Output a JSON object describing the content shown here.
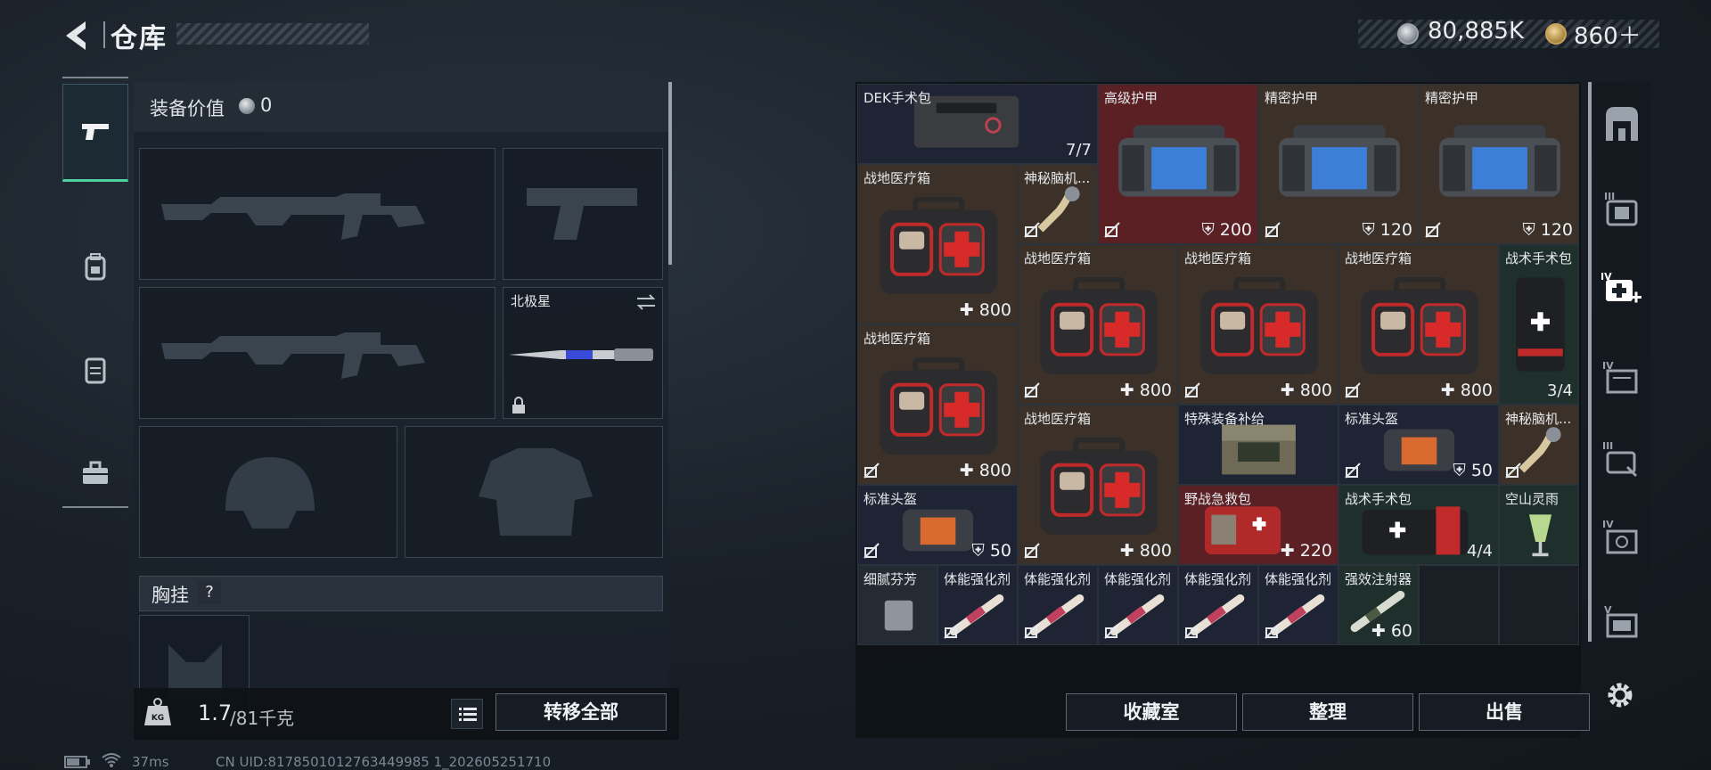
{
  "header": {
    "title": "仓库",
    "currency_silver": "80,885K",
    "currency_gold": "860＋"
  },
  "equipment": {
    "value_label": "装备价值",
    "value": "0",
    "melee_label": "北极星",
    "chest_label": "胸挂",
    "help": "?"
  },
  "weight": {
    "current": "1.7",
    "max": "/81千克",
    "transfer_all": "转移全部"
  },
  "status": {
    "ping": "37ms",
    "uid": "CN UID:8178501012763449985 1_202605251710"
  },
  "inventory": {
    "cells": [
      {
        "name": "DEK手术包",
        "count": "7/7"
      },
      {
        "name": "高级护甲",
        "value": "200"
      },
      {
        "name": "精密护甲",
        "value": "120"
      },
      {
        "name": "精密护甲",
        "value": "120"
      },
      {
        "name": "战地医疗箱",
        "value": "800"
      },
      {
        "name": "神秘脑机..."
      },
      {
        "name": "战地医疗箱",
        "value": "800"
      },
      {
        "name": "战地医疗箱",
        "value": "800"
      },
      {
        "name": "战地医疗箱",
        "value": "800"
      },
      {
        "name": "战术手术包",
        "count": "3/4"
      },
      {
        "name": "战地医疗箱",
        "value": "800"
      },
      {
        "name": "战地医疗箱",
        "value": "800"
      },
      {
        "name": "特殊装备补给"
      },
      {
        "name": "标准头盔",
        "value": "50"
      },
      {
        "name": "神秘脑机..."
      },
      {
        "name": "标准头盔",
        "value": "50"
      },
      {
        "name": "野战急救包",
        "value": "220"
      },
      {
        "name": "战术手术包",
        "count": "4/4"
      },
      {
        "name": "空山灵雨"
      },
      {
        "name": "细腻芬芳"
      },
      {
        "name": "体能强化剂"
      },
      {
        "name": "体能强化剂"
      },
      {
        "name": "体能强化剂"
      },
      {
        "name": "体能强化剂"
      },
      {
        "name": "体能强化剂"
      },
      {
        "name": "强效注射器",
        "value": "60"
      }
    ]
  },
  "buttons": {
    "collection": "收藏室",
    "organize": "整理",
    "sell": "出售"
  },
  "colors": {
    "active_tab_accent": "#4fd0a0",
    "rarity_red": "#5a2024",
    "rarity_brown": "#3b3128",
    "rarity_green": "#1f2f2b",
    "rarity_navy": "#1f2434"
  }
}
